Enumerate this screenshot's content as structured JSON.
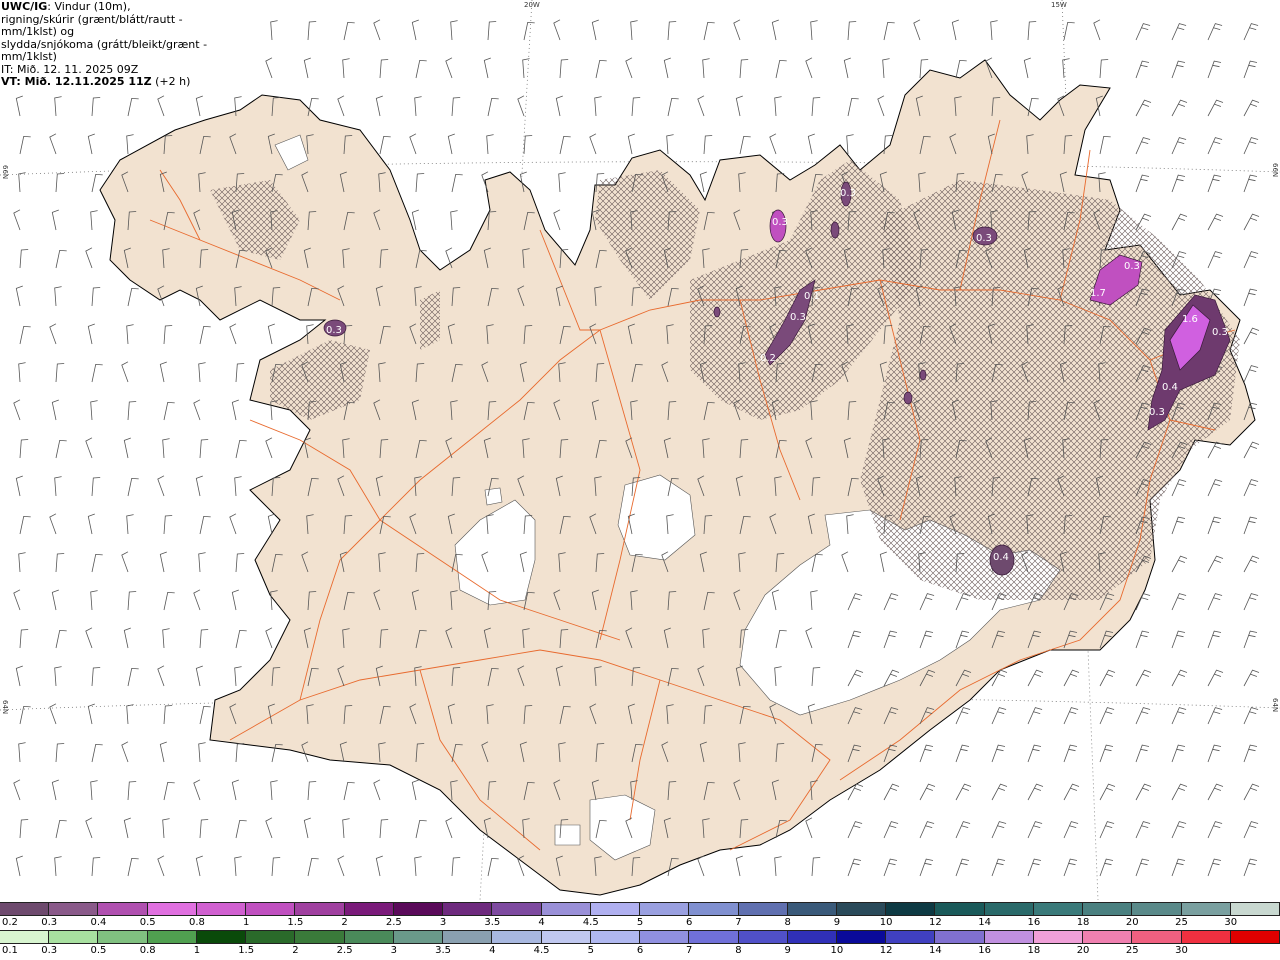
{
  "title": {
    "model": "UWC/IG",
    "line1": ": Vindur (10m),",
    "line2": "rigning/skúrir (grænt/blátt/rautt - mm/1klst) og",
    "line3": "slydda/snjókoma (grátt/bleikt/grænt - mm/1klst)",
    "it": "IT: Mið. 12. 11. 2025 09Z",
    "vt": "VT: Mið. 12.11.2025 11Z",
    "vt_suffix": " (+2 h)"
  },
  "coords": {
    "top_20w": "20W",
    "top_15w": "15W",
    "left_66n": "66N",
    "left_64n": "64N",
    "right_66n": "66N",
    "right_64n": "64N"
  },
  "precip_labels": [
    "0.3",
    "0.3",
    "0.3",
    "0.3",
    "1.7",
    "0.3",
    "0.4",
    "0.3",
    "0.1",
    "1.6",
    "0.3",
    "0.4",
    "0.3",
    "0.2"
  ],
  "colors": {
    "land": "#f2e2d0",
    "roads": "#e86a2e",
    "coast": "#000000",
    "glacier": "#ffffff",
    "wind_barb": "#555555"
  },
  "legend_snow": {
    "labels": [
      "0.2",
      "0.3",
      "0.4",
      "0.5",
      "0.8",
      "1",
      "1.5",
      "2",
      "2.5",
      "3",
      "3.5",
      "4",
      "4.5",
      "5",
      "6",
      "7",
      "8",
      "9",
      "10",
      "12",
      "14",
      "16",
      "18",
      "20",
      "25",
      "30"
    ],
    "colors": [
      "#6e4a6e",
      "#8a5a8a",
      "#b050b0",
      "#e070e0",
      "#d060d0",
      "#c050c0",
      "#a040a0",
      "#7a1a7a",
      "#5a0a5a",
      "#6e2a7e",
      "#7e4aa0",
      "#9a90d8",
      "#b0b0f0",
      "#9aa0e0",
      "#8090d0",
      "#6070b0",
      "#3a5a7a",
      "#2a4a5a",
      "#0e3a44",
      "#1a5a5a",
      "#2a6a6a",
      "#3a7a7a",
      "#4a8080",
      "#5a8a8a",
      "#7aa0a0",
      "#c8d8d0"
    ]
  },
  "legend_rain": {
    "labels": [
      "0.1",
      "0.3",
      "0.5",
      "0.8",
      "1",
      "1.5",
      "2",
      "2.5",
      "3",
      "3.5",
      "4",
      "4.5",
      "5",
      "6",
      "7",
      "8",
      "9",
      "10",
      "12",
      "14",
      "16",
      "18",
      "20",
      "25",
      "30"
    ],
    "colors": [
      "#d8f5d0",
      "#a8e0a0",
      "#80c080",
      "#50a050",
      "#0a4a0a",
      "#2a6a2a",
      "#3a7a3a",
      "#4a8a5a",
      "#6a9a8a",
      "#8aa0b0",
      "#a8b8e0",
      "#c0c8f0",
      "#b0b8f0",
      "#9090e0",
      "#7070d8",
      "#5050c8",
      "#3030b8",
      "#0a0a9a",
      "#4040c0",
      "#8070d0",
      "#c090e0",
      "#f0a0d8",
      "#f080b0",
      "#f06080",
      "#f03040",
      "#e00000"
    ]
  }
}
